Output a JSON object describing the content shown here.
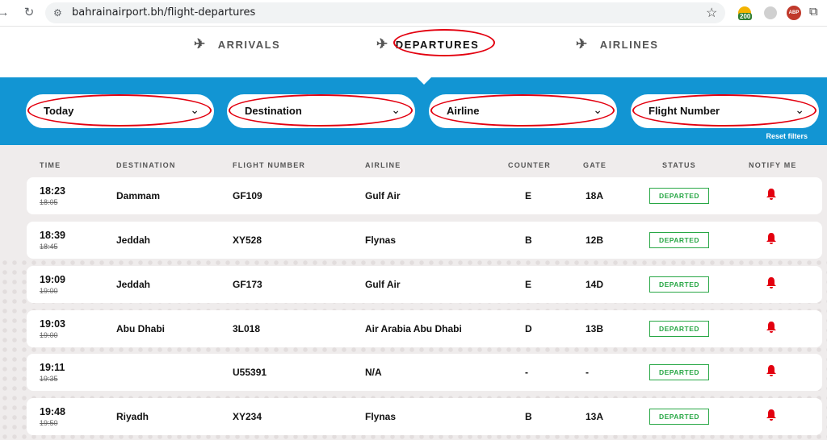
{
  "browser": {
    "url": "bahrainairport.bh/flight-departures",
    "ext_badge": "200",
    "ext_abp": "ABP"
  },
  "tabs": [
    {
      "label": "ARRIVALS",
      "icon": "landing-plane-icon"
    },
    {
      "label": "DEPARTURES",
      "icon": "takeoff-plane-icon"
    },
    {
      "label": "AIRLINES",
      "icon": "airplane-icon"
    }
  ],
  "filters": {
    "date": "Today",
    "destination": "Destination",
    "airline": "Airline",
    "flight_number": "Flight Number",
    "reset": "Reset filters"
  },
  "headers": {
    "time": "TIME",
    "destination": "DESTINATION",
    "flight_number": "FLIGHT NUMBER",
    "airline": "AIRLINE",
    "counter": "COUNTER",
    "gate": "GATE",
    "status": "STATUS",
    "notify": "NOTIFY ME"
  },
  "flights": [
    {
      "time": "18:23",
      "scheduled": "18:05",
      "destination": "Dammam",
      "flight": "GF109",
      "airline": "Gulf Air",
      "counter": "E",
      "gate": "18A",
      "status": "DEPARTED"
    },
    {
      "time": "18:39",
      "scheduled": "18:45",
      "destination": "Jeddah",
      "flight": "XY528",
      "airline": "Flynas",
      "counter": "B",
      "gate": "12B",
      "status": "DEPARTED"
    },
    {
      "time": "19:09",
      "scheduled": "19:00",
      "destination": "Jeddah",
      "flight": "GF173",
      "airline": "Gulf Air",
      "counter": "E",
      "gate": "14D",
      "status": "DEPARTED"
    },
    {
      "time": "19:03",
      "scheduled": "19:00",
      "destination": "Abu Dhabi",
      "flight": "3L018",
      "airline": "Air Arabia Abu Dhabi",
      "counter": "D",
      "gate": "13B",
      "status": "DEPARTED"
    },
    {
      "time": "19:11",
      "scheduled": "19:35",
      "destination": "",
      "flight": "U55391",
      "airline": "N/A",
      "counter": "-",
      "gate": "-",
      "status": "DEPARTED"
    },
    {
      "time": "19:48",
      "scheduled": "19:50",
      "destination": "Riyadh",
      "flight": "XY234",
      "airline": "Flynas",
      "counter": "B",
      "gate": "13A",
      "status": "DEPARTED"
    }
  ],
  "colors": {
    "accent_blue": "#1295d3",
    "status_green": "#28a745",
    "bell_red": "#e3000f",
    "annotation_red": "#e3000f"
  }
}
